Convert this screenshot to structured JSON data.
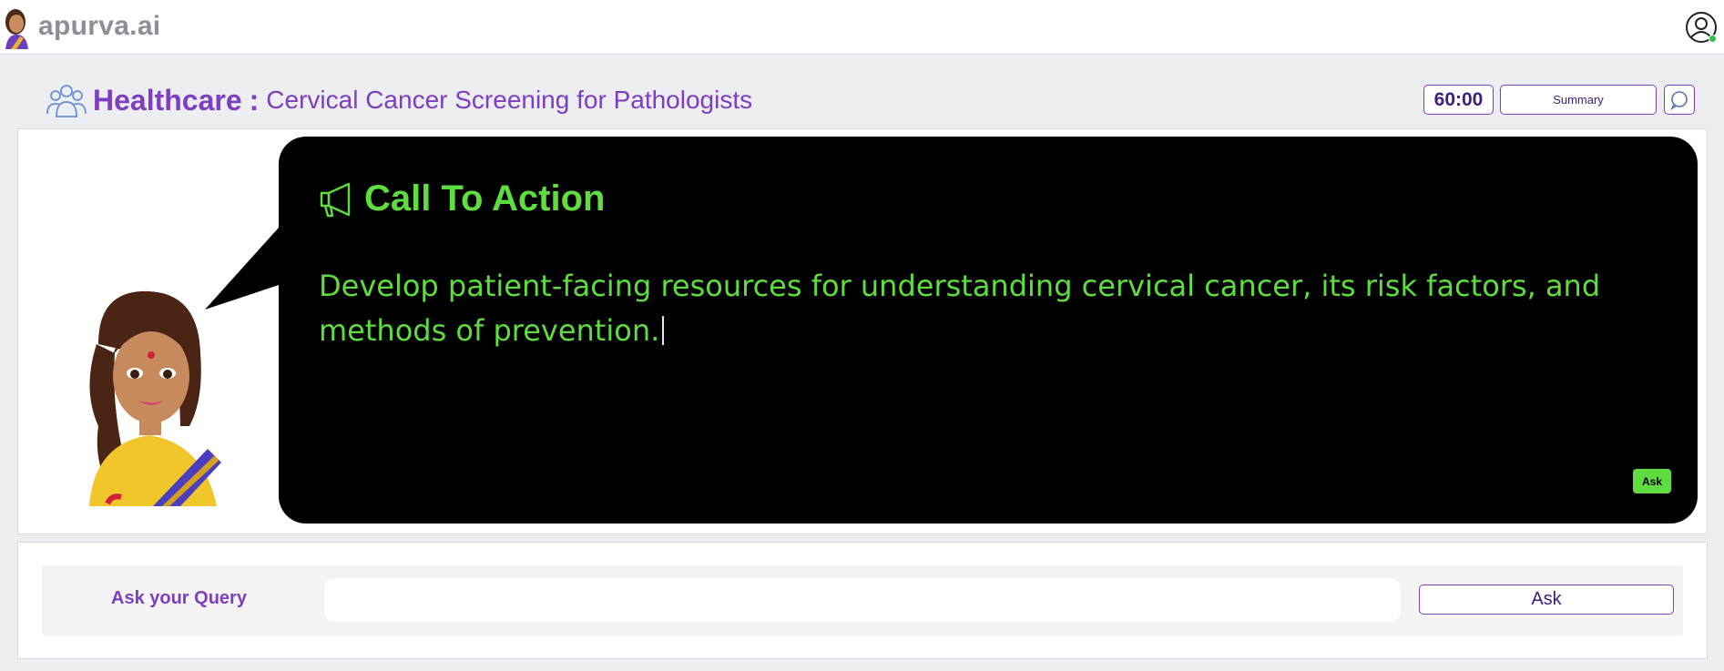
{
  "app": {
    "brand": "apurva.ai"
  },
  "header": {
    "category": "Healthcare",
    "separator": ":",
    "topic": "Cervical Cancer Screening for Pathologists",
    "timer": "60:00",
    "summary_label": "Summary"
  },
  "message": {
    "heading": "Call To Action",
    "body": "Develop patient-facing resources for understanding cervical cancer, its risk factors, and methods of prevention.",
    "ask_label": "Ask"
  },
  "query": {
    "label": "Ask your Query",
    "placeholder": "",
    "ask_label": "Ask"
  },
  "icons": {
    "brand_avatar": "female-avatar-icon",
    "user": "user-profile-icon",
    "group": "group-users-icon",
    "search": "search-chat-icon",
    "megaphone": "megaphone-icon"
  },
  "colors": {
    "accent_purple": "#7d3ec1",
    "text_green": "#5fdc3f",
    "bubble_bg": "#000000",
    "online_status": "#2fbf4a"
  }
}
